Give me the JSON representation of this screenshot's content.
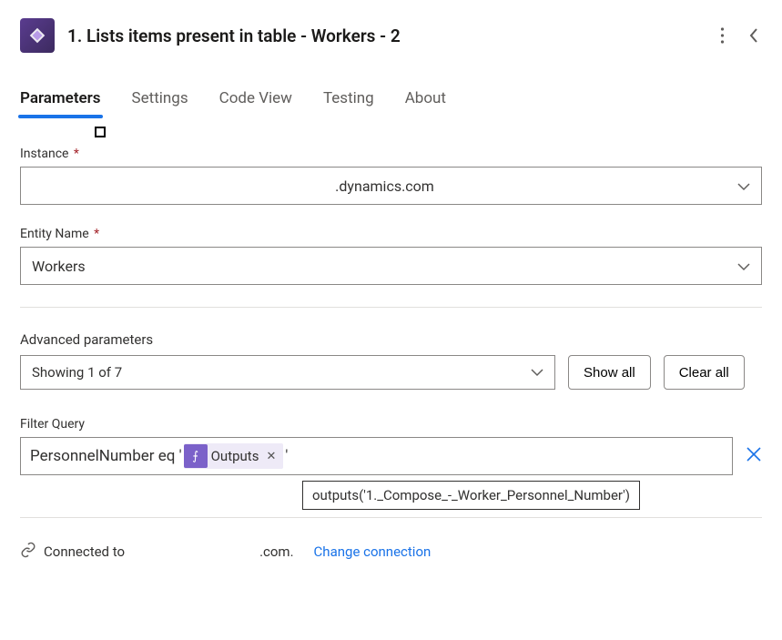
{
  "header": {
    "title": "1. Lists items present in table - Workers - 2"
  },
  "tabs": [
    {
      "label": "Parameters",
      "active": true
    },
    {
      "label": "Settings",
      "active": false
    },
    {
      "label": "Code View",
      "active": false
    },
    {
      "label": "Testing",
      "active": false
    },
    {
      "label": "About",
      "active": false
    }
  ],
  "fields": {
    "instance": {
      "label": "Instance",
      "value": ".dynamics.com",
      "required": true
    },
    "entity": {
      "label": "Entity Name",
      "value": "Workers",
      "required": true
    }
  },
  "advanced": {
    "label": "Advanced parameters",
    "select_value": "Showing 1 of 7",
    "show_all": "Show all",
    "clear_all": "Clear all"
  },
  "filter": {
    "label": "Filter Query",
    "prefix": "PersonnelNumber eq '",
    "token_label": "Outputs",
    "suffix": "'",
    "tooltip": "outputs('1._Compose_-_Worker_Personnel_Number')"
  },
  "connection": {
    "label": "Connected to",
    "domain": ".com.",
    "change": "Change connection"
  }
}
